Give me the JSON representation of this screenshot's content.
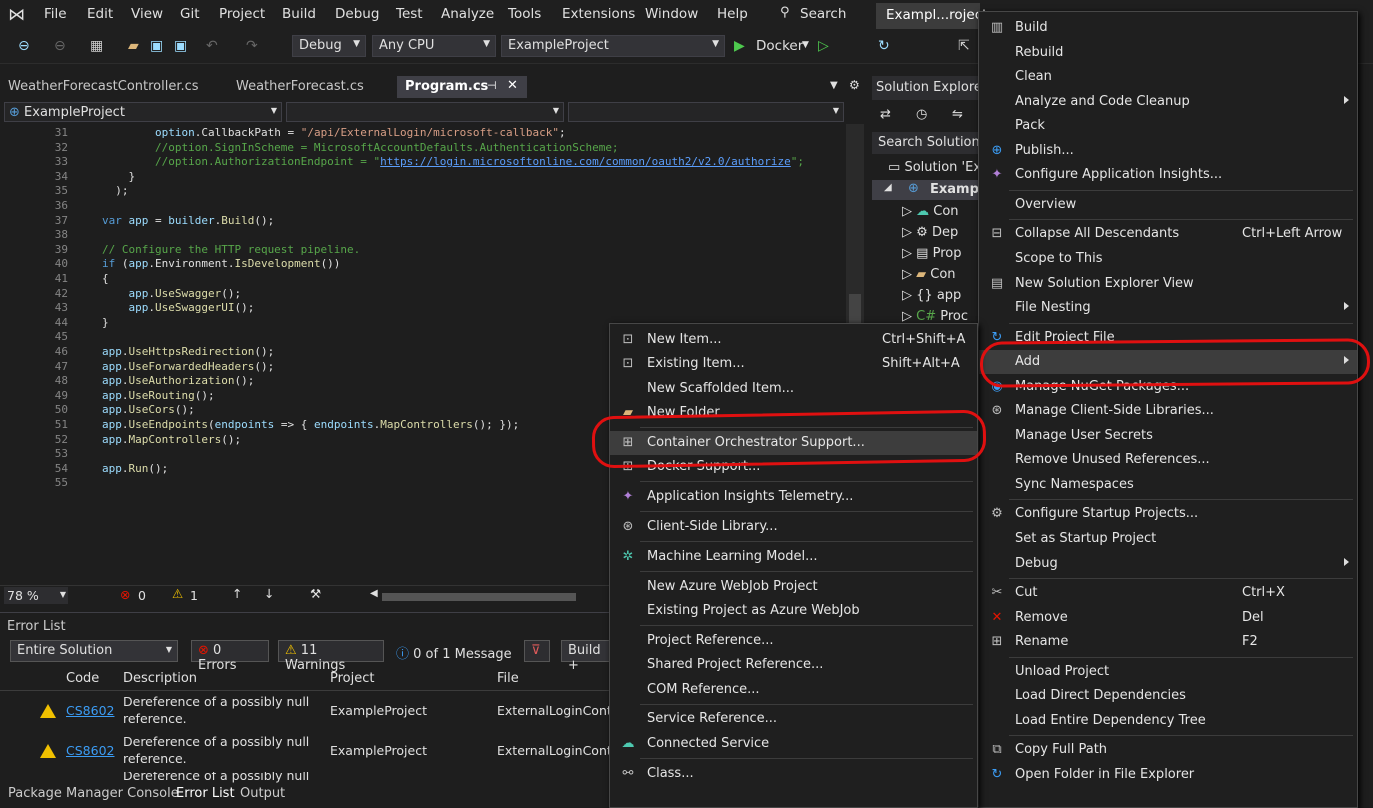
{
  "menu": [
    "File",
    "Edit",
    "View",
    "Git",
    "Project",
    "Build",
    "Debug",
    "Test",
    "Analyze",
    "Tools",
    "Extensions",
    "Window",
    "Help"
  ],
  "search_label": "Search",
  "title_tab": "Exampl...roject",
  "toolbar": {
    "config": "Debug",
    "platform": "Any CPU",
    "project": "ExampleProject",
    "run": "Docker"
  },
  "tabs": [
    "WeatherForecastController.cs",
    "WeatherForecast.cs",
    "Program.cs"
  ],
  "nav_project": "ExampleProject",
  "code_lines": [
    {
      "n": "31",
      "t": "        option.CallbackPath = \"/api/ExternalLogin/microsoft-callback\";"
    },
    {
      "n": "32",
      "t": "        //option.SignInScheme = MicrosoftAccountDefaults.AuthenticationScheme;"
    },
    {
      "n": "33",
      "t": "        //option.AuthorizationEndpoint = \"https://login.microsoftonline.com/common/oauth2/v2.0/authorize\";"
    },
    {
      "n": "34",
      "t": "    }"
    },
    {
      "n": "35",
      "t": "  );"
    },
    {
      "n": "36",
      "t": ""
    },
    {
      "n": "37",
      "t": "var app = builder.Build();"
    },
    {
      "n": "38",
      "t": ""
    },
    {
      "n": "39",
      "t": "// Configure the HTTP request pipeline."
    },
    {
      "n": "40",
      "t": "if (app.Environment.IsDevelopment())"
    },
    {
      "n": "41",
      "t": "{"
    },
    {
      "n": "42",
      "t": "    app.UseSwagger();"
    },
    {
      "n": "43",
      "t": "    app.UseSwaggerUI();"
    },
    {
      "n": "44",
      "t": "}"
    },
    {
      "n": "45",
      "t": ""
    },
    {
      "n": "46",
      "t": "app.UseHttpsRedirection();"
    },
    {
      "n": "47",
      "t": "app.UseForwardedHeaders();"
    },
    {
      "n": "48",
      "t": "app.UseAuthorization();"
    },
    {
      "n": "49",
      "t": "app.UseRouting();"
    },
    {
      "n": "50",
      "t": "app.UseCors();"
    },
    {
      "n": "51",
      "t": "app.UseEndpoints(endpoints => { endpoints.MapControllers(); });"
    },
    {
      "n": "52",
      "t": "app.MapControllers();"
    },
    {
      "n": "53",
      "t": ""
    },
    {
      "n": "54",
      "t": "app.Run();"
    },
    {
      "n": "55",
      "t": ""
    }
  ],
  "status": {
    "zoom": "78 %",
    "errors": "0",
    "warnings": "1"
  },
  "error_list": {
    "title": "Error List",
    "scope": "Entire Solution",
    "errors_btn": "0 Errors",
    "warnings_btn": "11 Warnings",
    "messages_btn": "0 of 1 Message",
    "build_btn": "Build +",
    "headers": [
      "Code",
      "Description",
      "Project",
      "File"
    ],
    "rows": [
      {
        "code": "CS8602",
        "desc1": "Dereference of a possibly null",
        "desc2": "reference.",
        "project": "ExampleProject",
        "file": "ExternalLoginContr"
      },
      {
        "code": "CS8602",
        "desc1": "Dereference of a possibly null",
        "desc2": "reference.",
        "project": "ExampleProject",
        "file": "ExternalLoginContr"
      },
      {
        "code": "",
        "desc1": "Dereference of a possibly null",
        "desc2": "",
        "project": "",
        "file": ""
      }
    ]
  },
  "bottom_tabs": [
    "Package Manager Console",
    "Error List",
    "Output"
  ],
  "solution_explorer": {
    "title": "Solution Explorer",
    "search": "Search Solution E",
    "items": [
      "Solution 'Ex",
      "Exampl",
      "Con",
      "Dep",
      "Prop",
      "Con",
      "app",
      "Proc"
    ]
  },
  "context_menu": [
    {
      "label": "Build",
      "icon": "build-icon"
    },
    {
      "label": "Rebuild"
    },
    {
      "label": "Clean"
    },
    {
      "label": "Analyze and Code Cleanup",
      "sub": true
    },
    {
      "label": "Pack"
    },
    {
      "label": "Publish...",
      "icon": "publish-icon"
    },
    {
      "label": "Configure Application Insights...",
      "icon": "insights-icon"
    },
    {
      "sep": true
    },
    {
      "label": "Overview"
    },
    {
      "sep": true
    },
    {
      "label": "Collapse All Descendants",
      "shortcut": "Ctrl+Left Arrow",
      "icon": "collapse-icon"
    },
    {
      "label": "Scope to This"
    },
    {
      "label": "New Solution Explorer View",
      "icon": "new-view-icon"
    },
    {
      "label": "File Nesting",
      "sub": true
    },
    {
      "sep": true
    },
    {
      "label": "Edit Project File",
      "icon": "edit-file-icon"
    },
    {
      "label": "Add",
      "sub": true,
      "highlight": true
    },
    {
      "label": "Manage NuGet Packages...",
      "icon": "nuget-icon"
    },
    {
      "label": "Manage Client-Side Libraries...",
      "icon": "library-icon"
    },
    {
      "label": "Manage User Secrets"
    },
    {
      "label": "Remove Unused References..."
    },
    {
      "label": "Sync Namespaces"
    },
    {
      "sep": true
    },
    {
      "label": "Configure Startup Projects...",
      "icon": "gear-icon"
    },
    {
      "label": "Set as Startup Project"
    },
    {
      "label": "Debug",
      "sub": true
    },
    {
      "sep": true
    },
    {
      "label": "Cut",
      "shortcut": "Ctrl+X",
      "icon": "cut-icon"
    },
    {
      "label": "Remove",
      "shortcut": "Del",
      "icon": "remove-icon"
    },
    {
      "label": "Rename",
      "shortcut": "F2",
      "icon": "rename-icon"
    },
    {
      "sep": true
    },
    {
      "label": "Unload Project"
    },
    {
      "label": "Load Direct Dependencies"
    },
    {
      "label": "Load Entire Dependency Tree"
    },
    {
      "sep": true
    },
    {
      "label": "Copy Full Path",
      "icon": "copy-icon"
    },
    {
      "label": "Open Folder in File Explorer",
      "icon": "open-folder-icon"
    }
  ],
  "add_submenu": [
    {
      "label": "New Item...",
      "shortcut": "Ctrl+Shift+A",
      "icon": "new-item-icon"
    },
    {
      "label": "Existing Item...",
      "shortcut": "Shift+Alt+A",
      "icon": "existing-item-icon"
    },
    {
      "label": "New Scaffolded Item..."
    },
    {
      "label": "New Folder",
      "icon": "folder-icon"
    },
    {
      "sep": true
    },
    {
      "label": "Container Orchestrator Support...",
      "icon": "container-icon",
      "highlight": true
    },
    {
      "label": "Docker Support...",
      "icon": "docker-icon"
    },
    {
      "sep": true
    },
    {
      "label": "Application Insights Telemetry...",
      "icon": "insights-icon"
    },
    {
      "sep": true
    },
    {
      "label": "Client-Side Library...",
      "icon": "library-icon"
    },
    {
      "sep": true
    },
    {
      "label": "Machine Learning Model...",
      "icon": "ml-icon"
    },
    {
      "sep": true
    },
    {
      "label": "New Azure WebJob Project"
    },
    {
      "label": "Existing Project as Azure WebJob"
    },
    {
      "sep": true
    },
    {
      "label": "Project Reference..."
    },
    {
      "label": "Shared Project Reference..."
    },
    {
      "label": "COM Reference..."
    },
    {
      "sep": true
    },
    {
      "label": "Service Reference..."
    },
    {
      "label": "Connected Service",
      "icon": "connected-icon"
    },
    {
      "sep": true
    },
    {
      "label": "Class...",
      "icon": "class-icon"
    }
  ],
  "colors": {
    "annotation": "#e01010",
    "accent": "#569cd6"
  }
}
